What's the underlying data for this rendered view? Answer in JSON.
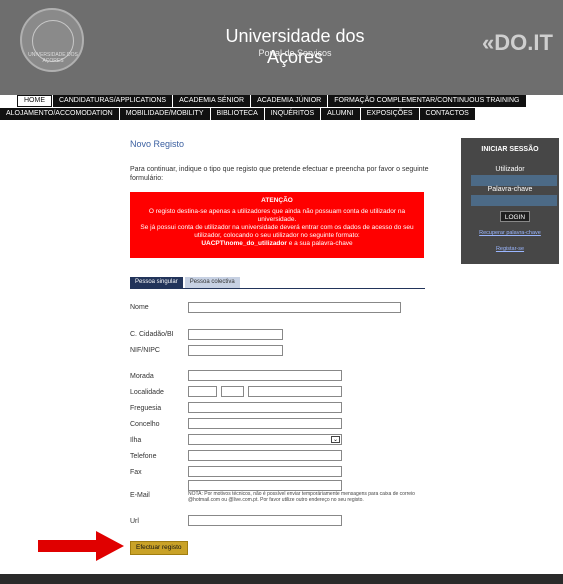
{
  "header": {
    "title": "Universidade dos Açores",
    "subtitle": "Portal de Serviços",
    "brand_right": "«DO.IT",
    "seal_text": "UNIVERSIDADE DOS AÇORES"
  },
  "nav": {
    "row1": [
      "HOME",
      "CANDIDATURAS/APPLICATIONS",
      "ACADEMIA SÉNIOR",
      "ACADEMIA JÚNIOR",
      "FORMAÇÃO COMPLEMENTAR/CONTINUOUS TRAINING"
    ],
    "row2": [
      "ALOJAMENTO/ACCOMODATION",
      "MOBILIDADE/MOBILITY",
      "BIBLIOTECA",
      "INQUÉRITOS",
      "ALUMNI",
      "EXPOSIÇÕES",
      "CONTACTOS"
    ]
  },
  "main": {
    "heading": "Novo Registo",
    "intro": "Para continuar, indique o tipo que registo que pretende efectuar e preencha por favor o seguinte formulário:",
    "alert_title": "ATENÇÃO",
    "alert_line1": "O registo destina-se apenas a utilizadores que ainda não possuam conta de utilizador na universidade.",
    "alert_line2": "Se já possui conta de utilizador na universidade deverá entrar com os dados de acesso do seu utilizador, colocando o seu utilizador no seguinte formato:",
    "alert_format": "UACPT\\nome_do_utilizador",
    "alert_suffix": " e a sua palavra-chave",
    "tab_single": "Pessoa singular",
    "tab_collective": "Pessoa colectiva",
    "labels": {
      "nome": "Nome",
      "cc": "C. Cidadão/BI",
      "nif": "NIF/NIPC",
      "morada": "Morada",
      "localidade": "Localidade",
      "freguesia": "Freguesia",
      "concelho": "Concelho",
      "ilha": "Ilha",
      "telefone": "Telefone",
      "fax": "Fax",
      "email": "E-Mail",
      "url": "Url"
    },
    "email_note": "NOTA: Por motivos técnicos, não é possível enviar temporáriamente mensagens para caixa de correio @hotmail.com ou @live.com.pt. Por favor utilize outro endereço no seu registo.",
    "submit": "Efectuar registo"
  },
  "sidebar": {
    "title": "INICIAR SESSÃO",
    "user_label": "Utilizador",
    "pass_label": "Palavra-chave",
    "login": "LOGIN",
    "recover": "Recuperar palavra-chave",
    "register": "Registar-se"
  },
  "colors": {
    "header_bg": "#6e6e6e",
    "alert_bg": "#ff0000",
    "submit_bg": "#c9a227",
    "arrow": "#e00000",
    "sidebar_bg": "#474747"
  }
}
